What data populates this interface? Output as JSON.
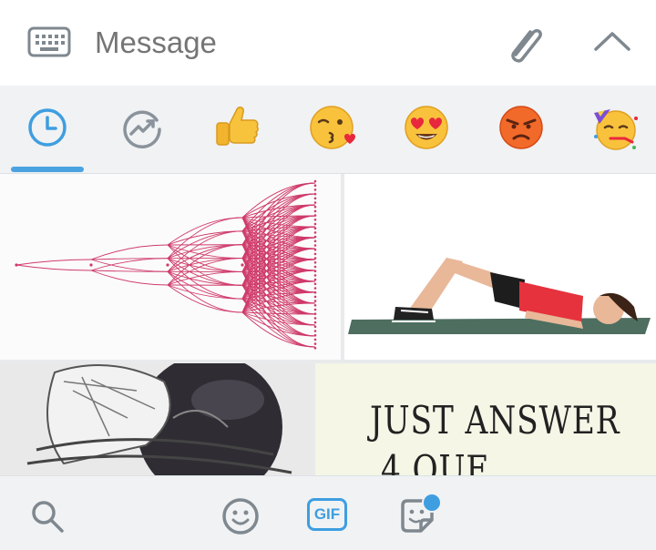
{
  "composer": {
    "placeholder": "Message"
  },
  "icons": {
    "keyboard": "keyboard-icon",
    "attach": "paperclip-icon",
    "collapse": "chevron-up-icon"
  },
  "tabs": [
    {
      "name": "recent",
      "icon": "clock-icon",
      "selected": true
    },
    {
      "name": "trending",
      "icon": "trending-icon",
      "selected": false
    },
    {
      "name": "thumbs-up",
      "icon": "thumbs-up-emoji",
      "selected": false
    },
    {
      "name": "kiss",
      "icon": "face-blowing-kiss-emoji",
      "selected": false
    },
    {
      "name": "heart-eyes",
      "icon": "heart-eyes-emoji",
      "selected": false
    },
    {
      "name": "angry",
      "icon": "angry-face-emoji",
      "selected": false
    },
    {
      "name": "party",
      "icon": "partying-face-emoji",
      "selected": false
    }
  ],
  "results": {
    "tile4": {
      "line1": "JUST ANSWER",
      "line2": "4 QUE"
    }
  },
  "bottom": {
    "search": "search-icon",
    "emoji": "smiley-icon",
    "gif_label": "GIF",
    "sticker": "sticker-icon"
  },
  "colors": {
    "accent": "#3e9ee0",
    "icon_gray": "#8a939b",
    "bar_bg": "#f0f2f4"
  }
}
